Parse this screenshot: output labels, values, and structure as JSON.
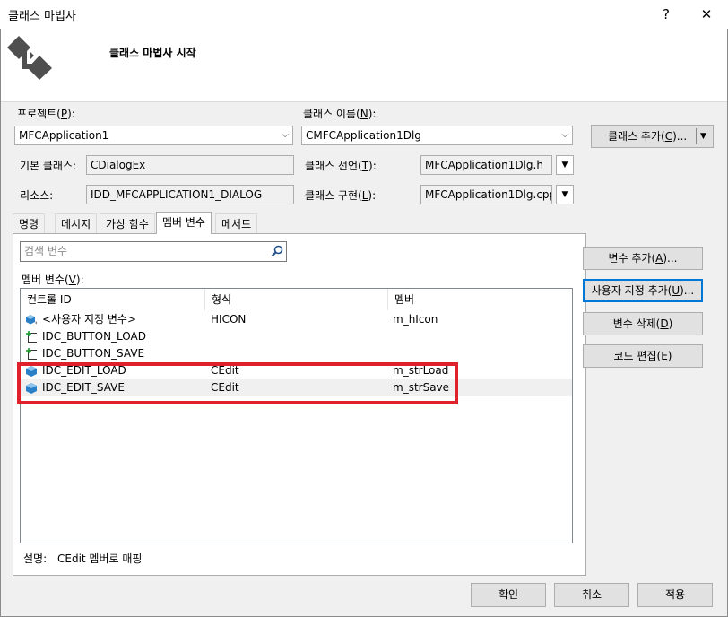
{
  "window": {
    "title": "클래스 마법사",
    "help_glyph": "?",
    "close_glyph": "✕"
  },
  "header": {
    "title": "클래스 마법사 시작"
  },
  "project": {
    "label": "프로젝트(",
    "mnemonic": "P",
    "label_end": "):",
    "value": "MFCApplication1"
  },
  "class_name": {
    "label": "클래스 이름(",
    "mnemonic": "N",
    "label_end": "):",
    "value": "CMFCApplication1Dlg"
  },
  "add_class_button": {
    "label": "클래스 추가(",
    "mnemonic": "C",
    "label_end": ")..."
  },
  "base_class": {
    "label": "기본 클래스:",
    "value": "CDialogEx"
  },
  "declaration": {
    "label": "클래스 선언(",
    "mnemonic": "T",
    "label_end": "):",
    "value": "MFCApplication1Dlg.h"
  },
  "resource": {
    "label": "리소스:",
    "value": "IDD_MFCAPPLICATION1_DIALOG"
  },
  "implementation": {
    "label": "클래스 구현(",
    "mnemonic": "L",
    "label_end": "):",
    "value": "MFCApplication1Dlg.cpp"
  },
  "tabs": [
    {
      "label": "명령"
    },
    {
      "label": "메시지"
    },
    {
      "label": "가상 함수"
    },
    {
      "label": "멤버 변수"
    },
    {
      "label": "메서드"
    }
  ],
  "search": {
    "placeholder": "검색 변수"
  },
  "members_label": {
    "label": "멤버 변수(",
    "mnemonic": "V",
    "label_end": "):"
  },
  "columns": {
    "control_id": "컨트롤 ID",
    "type": "형식",
    "member": "멤버"
  },
  "rows": [
    {
      "id": "<사용자 지정 변수>",
      "type": "HICON",
      "member": "m_hIcon",
      "icon": "custom-variable-icon"
    },
    {
      "id": "IDC_BUTTON_LOAD",
      "type": "",
      "member": "",
      "icon": "button-control-icon"
    },
    {
      "id": "IDC_BUTTON_SAVE",
      "type": "",
      "member": "",
      "icon": "button-control-icon"
    },
    {
      "id": "IDC_EDIT_LOAD",
      "type": "CEdit",
      "member": "m_strLoad",
      "icon": "edit-control-icon"
    },
    {
      "id": "IDC_EDIT_SAVE",
      "type": "CEdit",
      "member": "m_strSave",
      "icon": "edit-control-icon"
    }
  ],
  "side_buttons": {
    "add": {
      "label": "변수 추가(",
      "mnemonic": "A",
      "label_end": ")..."
    },
    "custom": {
      "label": "사용자 지정 추가(",
      "mnemonic": "U",
      "label_end": ")..."
    },
    "delete": {
      "label": "변수 삭제(",
      "mnemonic": "D",
      "label_end": ")"
    },
    "edit": {
      "label": "코드 편집(",
      "mnemonic": "E",
      "label_end": ")"
    }
  },
  "description": {
    "label": "설명:",
    "value": "CEdit 멤버로 매핑"
  },
  "footer": {
    "ok": "확인",
    "cancel": "취소",
    "apply": "적용"
  },
  "colors": {
    "highlight_box": "#e0202a",
    "selected_row": "#f0f0f0"
  }
}
